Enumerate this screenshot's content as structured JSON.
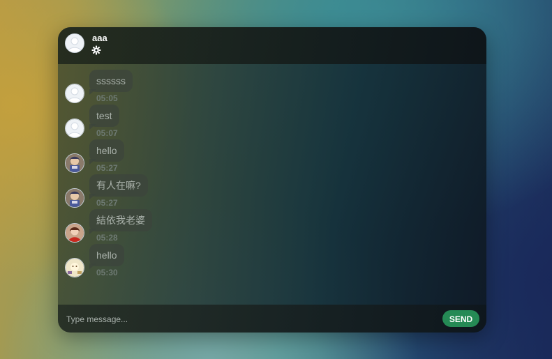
{
  "header": {
    "name": "aaa",
    "avatar_icon": "default-user-avatar",
    "settings_icon": "gear-icon"
  },
  "messages": [
    {
      "text": "ssssss",
      "time": "05:05",
      "avatar": "default-user-avatar"
    },
    {
      "text": "test",
      "time": "05:07",
      "avatar": "default-user-avatar"
    },
    {
      "text": "hello",
      "time": "05:27",
      "avatar": "photo-avatar-anime"
    },
    {
      "text": "有人在嘛?",
      "time": "05:27",
      "avatar": "photo-avatar-anime"
    },
    {
      "text": "結依我老婆",
      "time": "05:28",
      "avatar": "photo-avatar-red"
    },
    {
      "text": "hello",
      "time": "05:30",
      "avatar": "photo-avatar-cream"
    }
  ],
  "composer": {
    "placeholder": "Type message...",
    "send_label": "SEND"
  },
  "colors": {
    "send_button": "#258a55",
    "bubble_text": "#a9b1aa",
    "timestamp": "#6e7a73"
  }
}
